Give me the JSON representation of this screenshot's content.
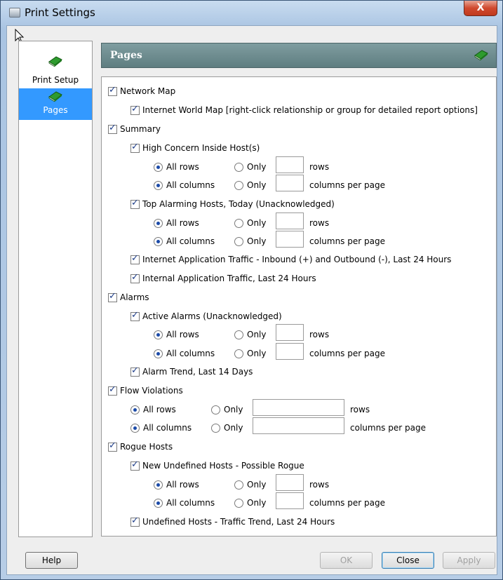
{
  "window": {
    "title": "Print Settings",
    "close_label": "X"
  },
  "nav": {
    "items": [
      {
        "label": "Print Setup"
      },
      {
        "label": "Pages"
      }
    ]
  },
  "panel": {
    "title": "Pages"
  },
  "options": {
    "network_map": "Network Map",
    "internet_world_map": "Internet World Map [right-click relationship or group for detailed report options]",
    "summary": "Summary",
    "high_concern": "High Concern Inside Host(s)",
    "top_alarming": "Top Alarming Hosts, Today (Unacknowledged)",
    "internet_app_traffic": "Internet Application Traffic - Inbound (+) and Outbound (-), Last 24 Hours",
    "internal_app_traffic": "Internal Application Traffic, Last 24 Hours",
    "alarms": "Alarms",
    "active_alarms": "Active Alarms (Unacknowledged)",
    "alarm_trend": "Alarm Trend, Last 14 Days",
    "flow_violations": "Flow Violations",
    "rogue_hosts": "Rogue Hosts",
    "new_undefined": "New Undefined Hosts - Possible Rogue",
    "undefined_trend": "Undefined Hosts - Traffic Trend, Last 24 Hours"
  },
  "labels": {
    "all_rows": "All rows",
    "all_columns": "All columns",
    "only": "Only",
    "rows": "rows",
    "columns_per_page": "columns per page"
  },
  "buttons": {
    "help": "Help",
    "ok": "OK",
    "close": "Close",
    "apply": "Apply"
  }
}
